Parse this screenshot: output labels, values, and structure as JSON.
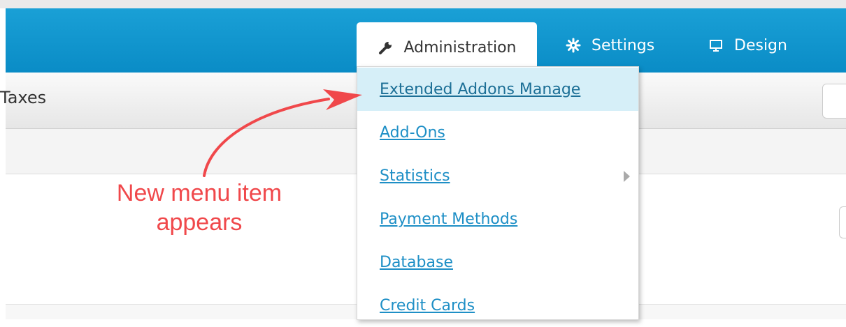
{
  "navbar": {
    "tabs": [
      {
        "label": "Administration",
        "icon": "wrench-icon"
      },
      {
        "label": "Settings",
        "icon": "gear-icon"
      },
      {
        "label": "Design",
        "icon": "monitor-icon"
      }
    ],
    "colors": {
      "bar": "#0a8cc6",
      "active_tab_bg": "#ffffff"
    }
  },
  "subbar": {
    "title": "Taxes"
  },
  "dropdown": {
    "items": [
      {
        "label": "Extended Addons Manage",
        "active": true
      },
      {
        "label": "Add-Ons"
      },
      {
        "label": "Statistics",
        "has_submenu": true
      },
      {
        "label": "Payment Methods"
      },
      {
        "label": "Database"
      },
      {
        "label": "Credit Cards"
      }
    ],
    "link_color": "#1e8fc6",
    "highlight_color": "#d6eff8"
  },
  "annotation": {
    "line1": "New menu item",
    "line2": "appears",
    "color": "#f0484b"
  }
}
